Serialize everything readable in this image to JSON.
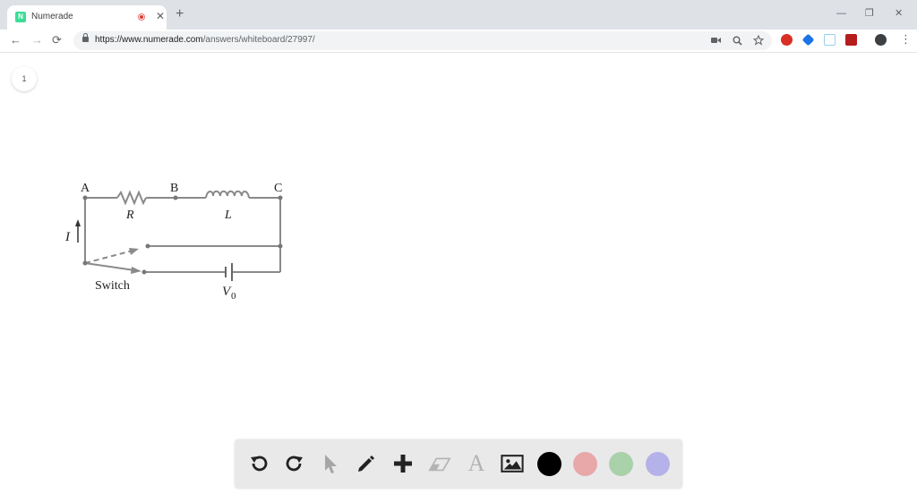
{
  "browser": {
    "tab": {
      "title": "Numerade",
      "favicon_letter": "N",
      "favicon_color": "#3ddc97",
      "recording_icon": "recording-dot-icon",
      "close_glyph": "✕"
    },
    "new_tab_glyph": "+",
    "window_controls": {
      "minimize": "—",
      "restore": "❐",
      "close": "✕"
    },
    "nav": {
      "back": "←",
      "forward": "→",
      "reload": "⟳"
    },
    "address": {
      "url_host": "https://www.numerade.com",
      "url_path": "/answers/whiteboard/27997/"
    },
    "omnibox_icons": [
      "camera-icon",
      "zoom-icon",
      "bookmark-star-icon"
    ],
    "extensions": [
      {
        "name": "adblock-icon",
        "color": "#d93025"
      },
      {
        "name": "shield-icon",
        "color": "#1a73e8"
      },
      {
        "name": "screen-icon",
        "color": "#9ad0ec"
      },
      {
        "name": "pdf-icon",
        "color": "#b71c1c"
      }
    ],
    "profile_icon": "profile-avatar-icon",
    "menu_glyph": "⋮"
  },
  "page": {
    "page_number": "1"
  },
  "circuit": {
    "node_labels": {
      "a": "A",
      "b": "B",
      "c": "C"
    },
    "component_labels": {
      "resistor": "R",
      "inductor": "L"
    },
    "current_label": "I",
    "switch_label": "Switch",
    "source_label": "V",
    "source_subscript": "0"
  },
  "toolbar": {
    "tools": [
      "undo-icon",
      "redo-icon",
      "pointer-icon",
      "pencil-icon",
      "add-icon",
      "eraser-icon",
      "text-tool-icon",
      "image-icon"
    ],
    "text_tool_glyph": "A",
    "colors": [
      "#000000",
      "#e8a7a9",
      "#a9d1aa",
      "#b4b2e8"
    ]
  }
}
